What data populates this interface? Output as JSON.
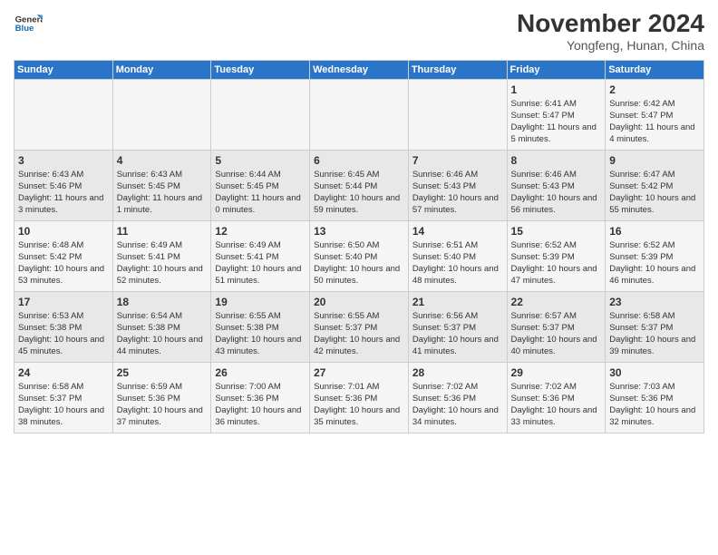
{
  "header": {
    "logo_general": "General",
    "logo_blue": "Blue",
    "month_title": "November 2024",
    "location": "Yongfeng, Hunan, China"
  },
  "days_of_week": [
    "Sunday",
    "Monday",
    "Tuesday",
    "Wednesday",
    "Thursday",
    "Friday",
    "Saturday"
  ],
  "weeks": [
    [
      {
        "day": "",
        "data": ""
      },
      {
        "day": "",
        "data": ""
      },
      {
        "day": "",
        "data": ""
      },
      {
        "day": "",
        "data": ""
      },
      {
        "day": "",
        "data": ""
      },
      {
        "day": "1",
        "data": "Sunrise: 6:41 AM\nSunset: 5:47 PM\nDaylight: 11 hours and 5 minutes."
      },
      {
        "day": "2",
        "data": "Sunrise: 6:42 AM\nSunset: 5:47 PM\nDaylight: 11 hours and 4 minutes."
      }
    ],
    [
      {
        "day": "3",
        "data": "Sunrise: 6:43 AM\nSunset: 5:46 PM\nDaylight: 11 hours and 3 minutes."
      },
      {
        "day": "4",
        "data": "Sunrise: 6:43 AM\nSunset: 5:45 PM\nDaylight: 11 hours and 1 minute."
      },
      {
        "day": "5",
        "data": "Sunrise: 6:44 AM\nSunset: 5:45 PM\nDaylight: 11 hours and 0 minutes."
      },
      {
        "day": "6",
        "data": "Sunrise: 6:45 AM\nSunset: 5:44 PM\nDaylight: 10 hours and 59 minutes."
      },
      {
        "day": "7",
        "data": "Sunrise: 6:46 AM\nSunset: 5:43 PM\nDaylight: 10 hours and 57 minutes."
      },
      {
        "day": "8",
        "data": "Sunrise: 6:46 AM\nSunset: 5:43 PM\nDaylight: 10 hours and 56 minutes."
      },
      {
        "day": "9",
        "data": "Sunrise: 6:47 AM\nSunset: 5:42 PM\nDaylight: 10 hours and 55 minutes."
      }
    ],
    [
      {
        "day": "10",
        "data": "Sunrise: 6:48 AM\nSunset: 5:42 PM\nDaylight: 10 hours and 53 minutes."
      },
      {
        "day": "11",
        "data": "Sunrise: 6:49 AM\nSunset: 5:41 PM\nDaylight: 10 hours and 52 minutes."
      },
      {
        "day": "12",
        "data": "Sunrise: 6:49 AM\nSunset: 5:41 PM\nDaylight: 10 hours and 51 minutes."
      },
      {
        "day": "13",
        "data": "Sunrise: 6:50 AM\nSunset: 5:40 PM\nDaylight: 10 hours and 50 minutes."
      },
      {
        "day": "14",
        "data": "Sunrise: 6:51 AM\nSunset: 5:40 PM\nDaylight: 10 hours and 48 minutes."
      },
      {
        "day": "15",
        "data": "Sunrise: 6:52 AM\nSunset: 5:39 PM\nDaylight: 10 hours and 47 minutes."
      },
      {
        "day": "16",
        "data": "Sunrise: 6:52 AM\nSunset: 5:39 PM\nDaylight: 10 hours and 46 minutes."
      }
    ],
    [
      {
        "day": "17",
        "data": "Sunrise: 6:53 AM\nSunset: 5:38 PM\nDaylight: 10 hours and 45 minutes."
      },
      {
        "day": "18",
        "data": "Sunrise: 6:54 AM\nSunset: 5:38 PM\nDaylight: 10 hours and 44 minutes."
      },
      {
        "day": "19",
        "data": "Sunrise: 6:55 AM\nSunset: 5:38 PM\nDaylight: 10 hours and 43 minutes."
      },
      {
        "day": "20",
        "data": "Sunrise: 6:55 AM\nSunset: 5:37 PM\nDaylight: 10 hours and 42 minutes."
      },
      {
        "day": "21",
        "data": "Sunrise: 6:56 AM\nSunset: 5:37 PM\nDaylight: 10 hours and 41 minutes."
      },
      {
        "day": "22",
        "data": "Sunrise: 6:57 AM\nSunset: 5:37 PM\nDaylight: 10 hours and 40 minutes."
      },
      {
        "day": "23",
        "data": "Sunrise: 6:58 AM\nSunset: 5:37 PM\nDaylight: 10 hours and 39 minutes."
      }
    ],
    [
      {
        "day": "24",
        "data": "Sunrise: 6:58 AM\nSunset: 5:37 PM\nDaylight: 10 hours and 38 minutes."
      },
      {
        "day": "25",
        "data": "Sunrise: 6:59 AM\nSunset: 5:36 PM\nDaylight: 10 hours and 37 minutes."
      },
      {
        "day": "26",
        "data": "Sunrise: 7:00 AM\nSunset: 5:36 PM\nDaylight: 10 hours and 36 minutes."
      },
      {
        "day": "27",
        "data": "Sunrise: 7:01 AM\nSunset: 5:36 PM\nDaylight: 10 hours and 35 minutes."
      },
      {
        "day": "28",
        "data": "Sunrise: 7:02 AM\nSunset: 5:36 PM\nDaylight: 10 hours and 34 minutes."
      },
      {
        "day": "29",
        "data": "Sunrise: 7:02 AM\nSunset: 5:36 PM\nDaylight: 10 hours and 33 minutes."
      },
      {
        "day": "30",
        "data": "Sunrise: 7:03 AM\nSunset: 5:36 PM\nDaylight: 10 hours and 32 minutes."
      }
    ]
  ]
}
